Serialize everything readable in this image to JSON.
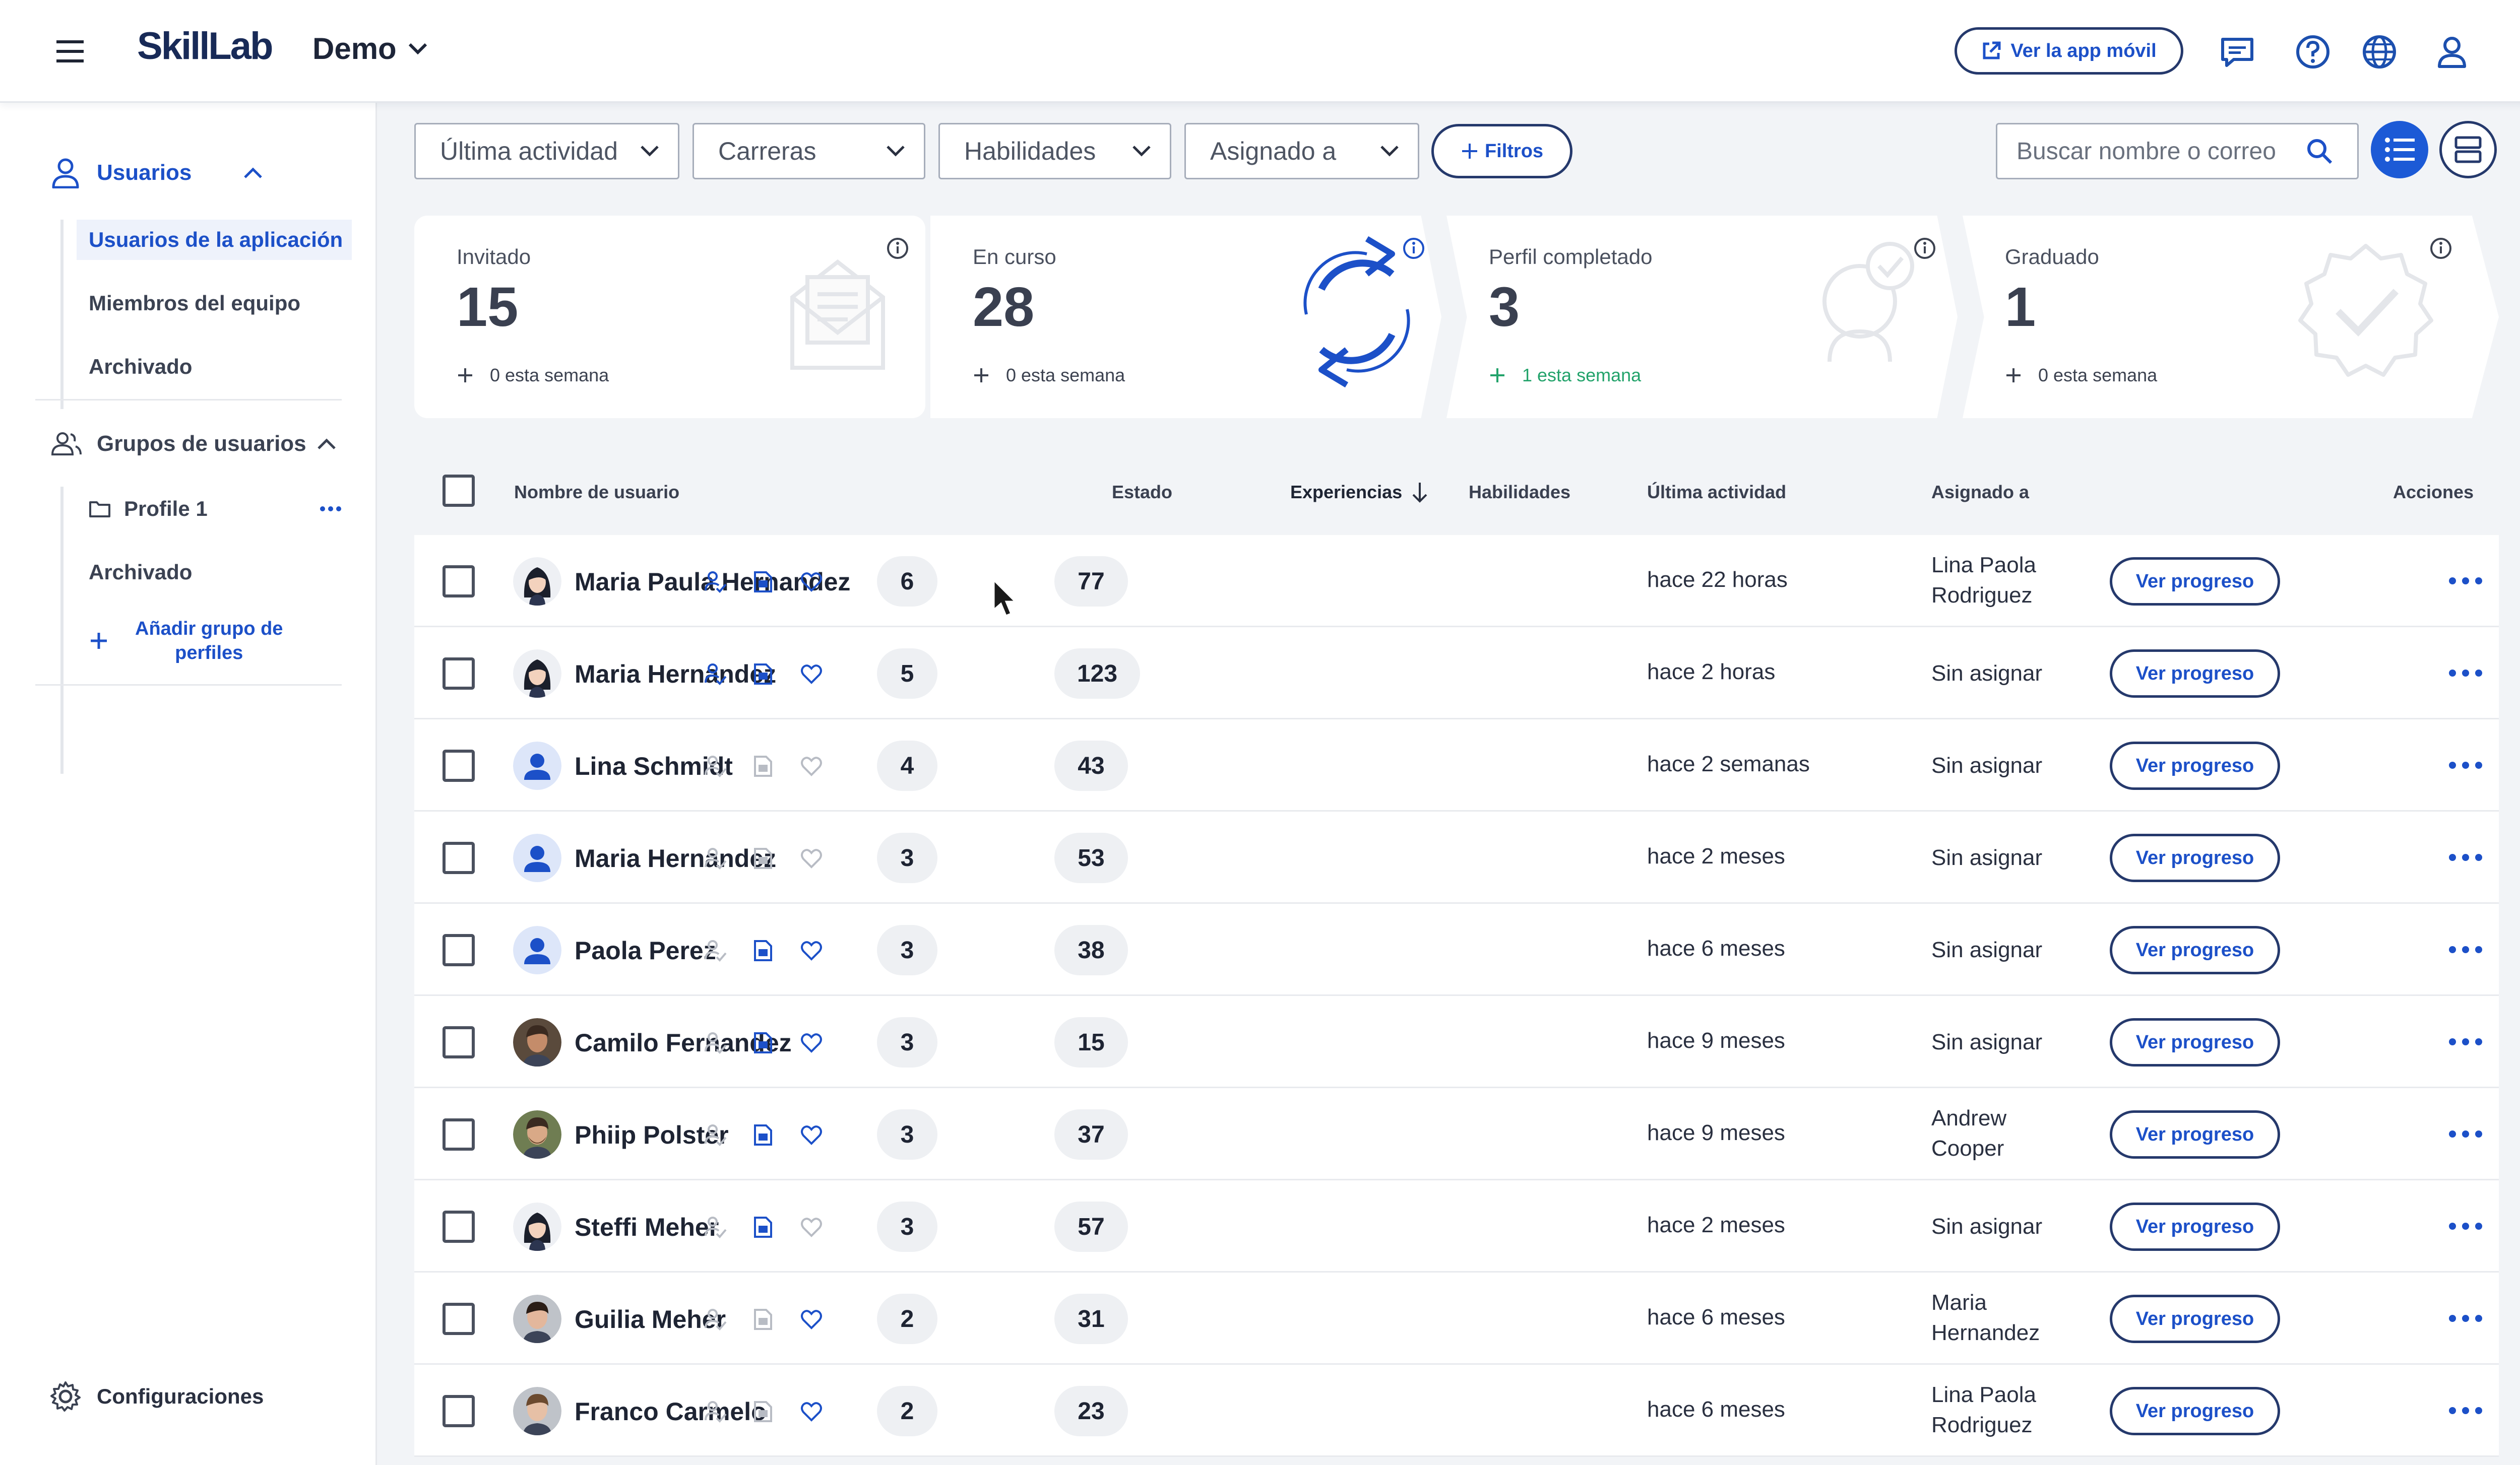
{
  "header": {
    "brand": "SkillLab",
    "workspace": "Demo",
    "mobile_button": "Ver la app móvil"
  },
  "sidebar": {
    "users_heading": "Usuarios",
    "users_items": [
      "Usuarios de la aplicación",
      "Miembros del equipo",
      "Archivado"
    ],
    "groups_heading": "Grupos de usuarios",
    "group_name": "Profile 1",
    "groups_archived": "Archivado",
    "add_group_line1": "Añadir grupo de",
    "add_group_line2": "perfiles",
    "settings": "Configuraciones"
  },
  "filters": {
    "last_activity": "Última actividad",
    "careers": "Carreras",
    "skills": "Habilidades",
    "assigned": "Asignado a",
    "more_filters": "Filtros",
    "search_placeholder": "Buscar nombre o correo"
  },
  "cards": [
    {
      "title": "Invitado",
      "value": "15",
      "foot": "0 esta semana"
    },
    {
      "title": "En curso",
      "value": "28",
      "foot": "0 esta semana"
    },
    {
      "title": "Perfil completado",
      "value": "3",
      "foot": "1 esta semana"
    },
    {
      "title": "Graduado",
      "value": "1",
      "foot": "0 esta semana"
    }
  ],
  "table": {
    "columns": {
      "name": "Nombre de usuario",
      "status": "Estado",
      "experiences": "Experiencias",
      "skills": "Habilidades",
      "last_activity": "Última actividad",
      "assigned": "Asignado a",
      "actions": "Acciones"
    },
    "button_label": "Ver progreso",
    "rows": [
      {
        "name": "Maria Paula Hernandez",
        "exp": "6",
        "skills": "77",
        "activity": "hace 22 horas",
        "assigned1": "Lina Paola",
        "assigned2": "Rodriguez"
      },
      {
        "name": "Maria Hernandez",
        "exp": "5",
        "skills": "123",
        "activity": "hace 2 horas",
        "assigned1": "Sin asignar",
        "assigned2": ""
      },
      {
        "name": "Lina Schmidt",
        "exp": "4",
        "skills": "43",
        "activity": "hace 2 semanas",
        "assigned1": "Sin asignar",
        "assigned2": ""
      },
      {
        "name": "Maria Hernandez",
        "exp": "3",
        "skills": "53",
        "activity": "hace 2 meses",
        "assigned1": "Sin asignar",
        "assigned2": ""
      },
      {
        "name": "Paola Perez",
        "exp": "3",
        "skills": "38",
        "activity": "hace 6 meses",
        "assigned1": "Sin asignar",
        "assigned2": ""
      },
      {
        "name": "Camilo Fernandez",
        "exp": "3",
        "skills": "15",
        "activity": "hace 9 meses",
        "assigned1": "Sin asignar",
        "assigned2": ""
      },
      {
        "name": "Phiip Polster",
        "exp": "3",
        "skills": "37",
        "activity": "hace 9 meses",
        "assigned1": "Andrew",
        "assigned2": "Cooper"
      },
      {
        "name": "Steffi Meher",
        "exp": "3",
        "skills": "57",
        "activity": "hace 2 meses",
        "assigned1": "Sin asignar",
        "assigned2": ""
      },
      {
        "name": "Guilia Meher",
        "exp": "2",
        "skills": "31",
        "activity": "hace 6 meses",
        "assigned1": "Maria",
        "assigned2": "Hernandez"
      },
      {
        "name": "Franco Carmelo",
        "exp": "2",
        "skills": "23",
        "activity": "hace 6 meses",
        "assigned1": "Lina Paola",
        "assigned2": "Rodriguez"
      }
    ]
  },
  "colors": {
    "accent": "#1c50c8",
    "brand_dark": "#182a57",
    "muted_icon": "#b8bcc4",
    "positive": "#23a36b"
  }
}
